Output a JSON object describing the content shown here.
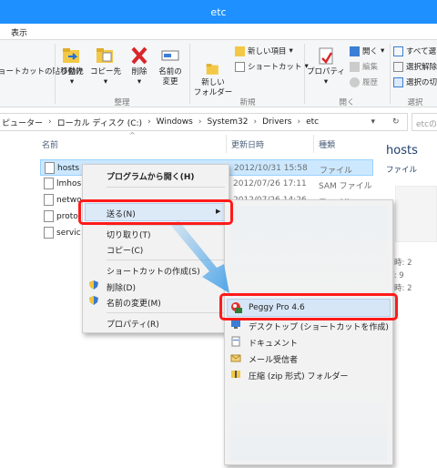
{
  "window": {
    "title": "etc"
  },
  "menubar": {
    "view_tab": "表示"
  },
  "ribbon": {
    "paste_shortcut": "ョートカットの貼り付け",
    "move_to": "移動先",
    "copy_to": "コピー先",
    "delete": "削除",
    "rename_l1": "名前の",
    "rename_l2": "変更",
    "organize_group": "整理",
    "new_folder_l1": "新しい",
    "new_folder_l2": "フォルダー",
    "new_item": "新しい項目",
    "shortcut": "ショートカット",
    "new_group": "新規",
    "properties": "プロパティ",
    "open": "開く",
    "edit": "編集",
    "history": "履歴",
    "open_group": "開く",
    "select_all": "すべて選",
    "select_none": "選択解除",
    "invert_selection": "選択の切",
    "select_group": "選択"
  },
  "address": {
    "crumbs": [
      "ピューター",
      "ローカル ディスク (C:)",
      "Windows",
      "System32",
      "Drivers",
      "etc"
    ],
    "search_placeholder": "etcの"
  },
  "columns": {
    "name": "名前",
    "date": "更新日時",
    "type": "種類"
  },
  "files": [
    {
      "name": "hosts",
      "date": "2012/10/31 15:58",
      "type": "ファイル"
    },
    {
      "name": "lmhos",
      "date": "2012/07/26 17:11",
      "type": "SAM ファイル"
    },
    {
      "name": "netwo",
      "date": "2012/07/26 14:26",
      "type": "ファイル"
    },
    {
      "name": "proto",
      "date": "",
      "type": ""
    },
    {
      "name": "servic",
      "date": "",
      "type": ""
    }
  ],
  "preview": {
    "filename": "hosts",
    "filetype": "ファイル",
    "meta": [
      "新日時: 2",
      "イズ: 9",
      "成日時: 2"
    ]
  },
  "context_menu": {
    "items": [
      "プログラムから開く(H)",
      "送る(N)",
      "切り取り(T)",
      "コピー(C)",
      "ショートカットの作成(S)",
      "削除(D)",
      "名前の変更(M)",
      "プロパティ(R)"
    ]
  },
  "sendto_menu": {
    "items": [
      "Peggy Pro 4.6",
      "デスクトップ (ショートカットを作成)",
      "ドキュメント",
      "メール受信者",
      "圧縮 (zip 形式) フォルダー"
    ]
  },
  "colors": {
    "titlebar": "#1e90ff",
    "highlight": "#ff1a1a",
    "selection": "#cce8ff",
    "arrow": "#4aa3e8"
  }
}
